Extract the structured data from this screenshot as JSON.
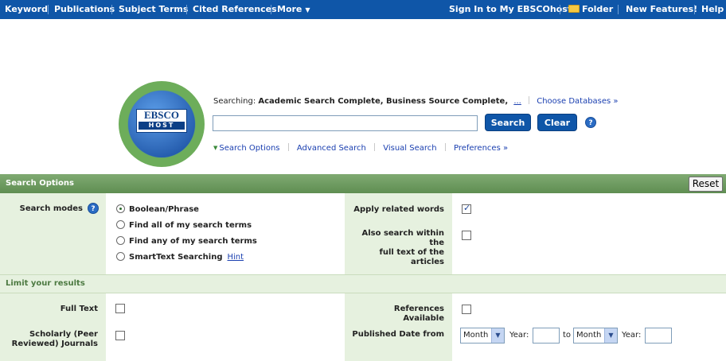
{
  "topbar": {
    "left_items": [
      "Keyword",
      "Publications",
      "Subject Terms",
      "Cited References",
      "More"
    ],
    "right_items": [
      "Sign In to My EBSCOhost",
      "Folder",
      "New Features!",
      "Help"
    ]
  },
  "logo": {
    "line1": "EBSCO",
    "line2": "HOST"
  },
  "search": {
    "searching_label": "Searching:",
    "databases": "Academic Search Complete, Business Source Complete,",
    "more": "...",
    "choose_databases": "Choose Databases »",
    "input_value": "",
    "search_button": "Search",
    "clear_button": "Clear",
    "help": "?"
  },
  "search_links": {
    "search_options": "Search Options",
    "advanced_search": "Advanced Search",
    "visual_search": "Visual Search",
    "preferences": "Preferences »"
  },
  "panel": {
    "title": "Search Options",
    "reset": "Reset",
    "search_modes_label": "Search modes",
    "modes": [
      {
        "label": "Boolean/Phrase",
        "selected": true
      },
      {
        "label": "Find all of my search terms",
        "selected": false
      },
      {
        "label": "Find any of my search terms",
        "selected": false
      },
      {
        "label": "SmartText Searching",
        "selected": false
      }
    ],
    "hint": "Hint",
    "apply_related_words": "Apply related words",
    "apply_related_checked": true,
    "fulltext_within_line1": "Also search within the",
    "fulltext_within_line2": "full text of the articles",
    "fulltext_within_checked": false
  },
  "limits": {
    "title": "Limit your results",
    "full_text": "Full Text",
    "scholarly_line1": "Scholarly (Peer",
    "scholarly_line2": "Reviewed) Journals",
    "references_available": "References Available",
    "published_date_from": "Published Date from",
    "month": "Month",
    "year_label": "Year:",
    "to": "to",
    "year_from": "",
    "year_to": ""
  },
  "colors": {
    "nav_blue": "#0f56a8",
    "panel_green": "#6e9c61",
    "label_bg": "#e6f1df"
  }
}
